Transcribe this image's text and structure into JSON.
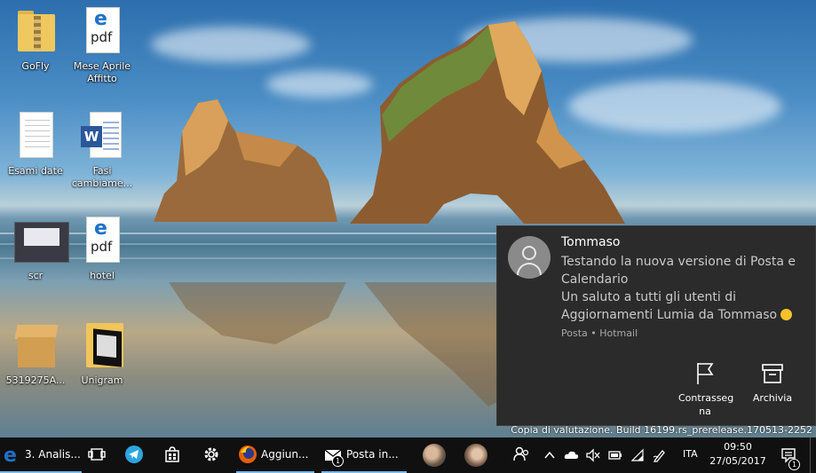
{
  "desktop": {
    "icons": [
      {
        "label": "GoFly",
        "icon": "zip-folder-icon"
      },
      {
        "label": "Mese Aprile Affitto",
        "icon": "edge-pdf-icon"
      },
      {
        "label": "Esami date",
        "icon": "text-document-icon"
      },
      {
        "label": "Fasi cambiame...",
        "icon": "word-document-icon"
      },
      {
        "label": "scr",
        "icon": "screenshot-thumbnail-icon"
      },
      {
        "label": "hotel",
        "icon": "edge-pdf-icon"
      },
      {
        "label": "5319275A...",
        "icon": "package-box-icon"
      },
      {
        "label": "Unigram",
        "icon": "unigram-folder-icon"
      }
    ],
    "pdf_mark": "e",
    "pdf_text": "pdf",
    "word_mark": "W"
  },
  "notification": {
    "sender": "Tommaso",
    "message_lines": [
      "Testando la nuova versione di Posta e",
      "Calendario",
      "Un saluto a tutti gli utenti di",
      "Aggiornamenti Lumia da Tommaso"
    ],
    "source": "Posta • Hotmail",
    "actions": [
      {
        "label": "Contrasseg na",
        "icon": "flag-icon"
      },
      {
        "label": "Archivia",
        "icon": "archive-icon"
      }
    ]
  },
  "watermark": "Copia di valutazione. Build 16199.rs_prerelease.170513-2252",
  "taskbar": {
    "apps": [
      {
        "label": "3. Analis...",
        "icon": "edge-icon"
      },
      {
        "label": "",
        "icon": "task-view-icon"
      },
      {
        "label": "",
        "icon": "telegram-icon"
      },
      {
        "label": "",
        "icon": "store-icon"
      },
      {
        "label": "",
        "icon": "settings-gear-icon"
      },
      {
        "label": "Aggiun...",
        "icon": "firefox-icon"
      },
      {
        "label": "Posta in...",
        "icon": "mail-icon",
        "badge": "1"
      },
      {
        "label": "",
        "icon": "contact-photo-icon"
      },
      {
        "label": "",
        "icon": "contact-photo-icon"
      },
      {
        "label": "",
        "icon": "people-icon"
      }
    ],
    "tray_icons": [
      "chevron-up-icon",
      "onedrive-cloud-icon",
      "volume-muted-icon",
      "battery-icon",
      "wifi-icon",
      "pen-icon"
    ],
    "language": "ITA",
    "time": "09:50",
    "date": "27/05/2017",
    "action_center_badge": "1"
  },
  "colors": {
    "taskbar": "#101010",
    "toast_bg": "#2b2b2b",
    "accent": "#76b9ed",
    "edge_blue": "#1e72c8",
    "word_blue": "#2b579a"
  }
}
